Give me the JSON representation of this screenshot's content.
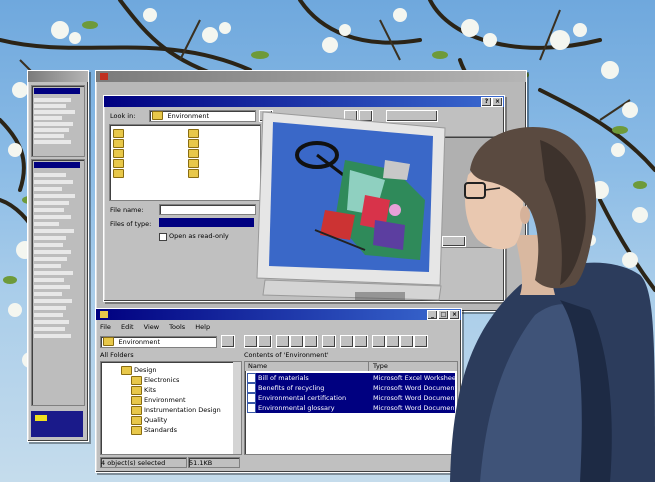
{
  "sidebar_window": {
    "title": "",
    "items_top": [
      "",
      "",
      "",
      "",
      "",
      "",
      "",
      "",
      "",
      "",
      ""
    ],
    "items_bottom": [
      "",
      "",
      "",
      "",
      "",
      "",
      "",
      "",
      "",
      "",
      "",
      "",
      "",
      "",
      "",
      "",
      "",
      "",
      "",
      "",
      ""
    ]
  },
  "file_dialog": {
    "window_title": "",
    "dialog_title": "",
    "look_in_label": "Look in:",
    "look_in_value": "Environment",
    "folders_left": [
      "",
      "",
      "",
      "",
      ""
    ],
    "folders_right": [
      "",
      "",
      "",
      "",
      ""
    ],
    "file_name_label": "File name:",
    "file_name_value": "",
    "files_of_type_label": "Files of type:",
    "files_of_type_value": "",
    "open_read_only_label": "Open as read-only",
    "preview_label": ""
  },
  "explorer": {
    "title": "",
    "menu": [
      "File",
      "Edit",
      "View",
      "Tools",
      "Help"
    ],
    "address_value": "Environment",
    "all_folders_label": "All Folders",
    "contents_label": "Contents of 'Environment'",
    "tree": [
      "Design",
      "Electronics",
      "Kits",
      "Environment",
      "Instrumentation Design",
      "Quality",
      "Standards"
    ],
    "columns": [
      "Name",
      "Type"
    ],
    "files": [
      {
        "name": "Bill of materials",
        "type": "Microsoft Excel Worksheet"
      },
      {
        "name": "Benefits of recycling",
        "type": "Microsoft Word Document"
      },
      {
        "name": "Environmental certification",
        "type": "Microsoft Word Document"
      },
      {
        "name": "Environmental glossary",
        "type": "Microsoft Word Document"
      }
    ],
    "status_left": "4 object(s) selected",
    "status_right": "51.1KB"
  },
  "colors": {
    "titlebar_active": "#000080",
    "window_face": "#c0c0c0",
    "highlight": "#000080",
    "cad_background": "#3a68c8"
  }
}
